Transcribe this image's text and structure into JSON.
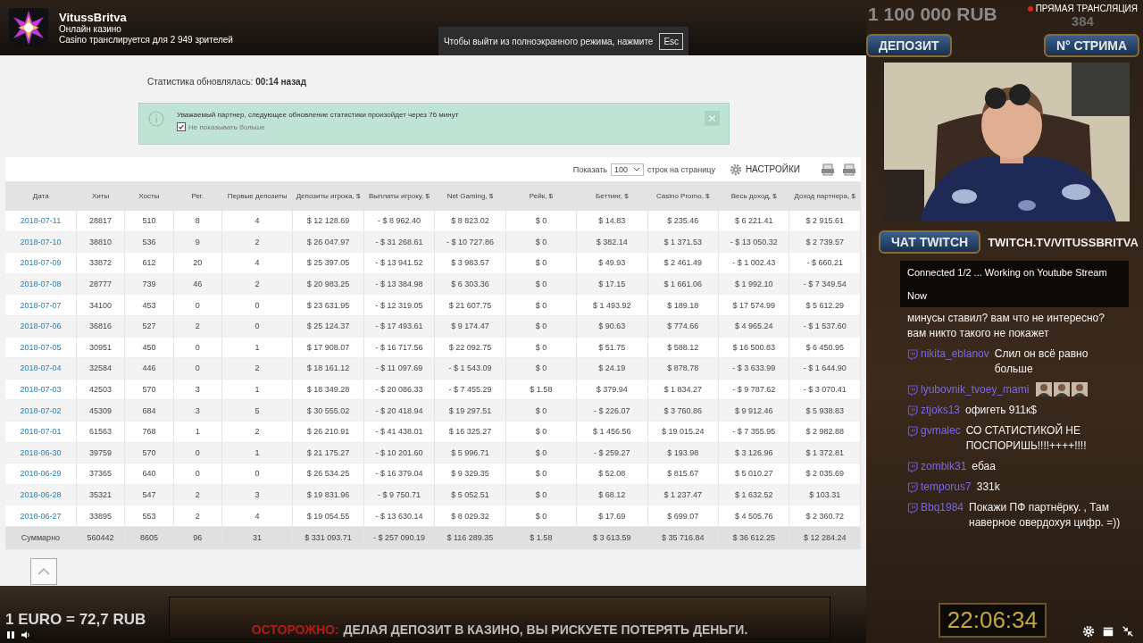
{
  "stream_header": {
    "channel": "VitussBritva",
    "subtitle": "Онлайн казино",
    "viewers": "Casino транслируется для 2 949 зрителей"
  },
  "fullscreen_notice": {
    "text": "Чтобы выйти из полноэкранного режима, нажмите",
    "key": "Esc"
  },
  "stats_updated": "Статистика обновлялась: **00:14 назад**",
  "alert": {
    "text": "Уважаемый партнер, следующее обновление статистики произойдет через 76 минут",
    "checkbox": {
      "label": "Не показывать больше",
      "checked": true
    }
  },
  "table_toolbar": {
    "show_label": "Показать",
    "page_size": "100",
    "per_page_label": "строк на страницу",
    "settings": "НАСТРОЙКИ"
  },
  "table": {
    "columns": [
      "Дата",
      "Хиты",
      "Хосты",
      "Рег.",
      "Первые депозиты",
      "Депозиты игрока, $",
      "Выплаты игроку, $",
      "Net Gaming, $",
      "Рейк, $",
      "Беттинг, $",
      "Casino Promo, $",
      "Весь доход, $",
      "Доход партнера, $"
    ],
    "rows": [
      [
        "2018-07-11",
        "28817",
        "510",
        "8",
        "4",
        "$ 12 128.69",
        "- $ 8 962.40",
        "$ 8 823.02",
        "$ 0",
        "$ 14.83",
        "$ 235.46",
        "$ 6 221.41",
        "$ 2 915.61"
      ],
      [
        "2018-07-10",
        "38810",
        "536",
        "9",
        "2",
        "$ 26 047.97",
        "- $ 31 268.61",
        "- $ 10 727.86",
        "$ 0",
        "$ 382.14",
        "$ 1 371.53",
        "- $ 13 050.32",
        "$ 2 739.57"
      ],
      [
        "2018-07-09",
        "33872",
        "612",
        "20",
        "4",
        "$ 25 397.05",
        "- $ 13 941.52",
        "$ 3 983.57",
        "$ 0",
        "$ 49.93",
        "$ 2 461.49",
        "- $ 1 002.43",
        "- $ 660.21"
      ],
      [
        "2018-07-08",
        "28777",
        "739",
        "46",
        "2",
        "$ 20 983.25",
        "- $ 13 384.98",
        "$ 6 303.36",
        "$ 0",
        "$ 17.15",
        "$ 1 661.06",
        "$ 1 992.10",
        "- $ 7 349.54"
      ],
      [
        "2018-07-07",
        "34100",
        "453",
        "0",
        "0",
        "$ 23 631.95",
        "- $ 12 319.05",
        "$ 21 607.75",
        "$ 0",
        "$ 1 493.92",
        "$ 189.18",
        "$ 17 574.99",
        "$ 5 612.29"
      ],
      [
        "2018-07-06",
        "36816",
        "527",
        "2",
        "0",
        "$ 25 124.37",
        "- $ 17 493.61",
        "$ 9 174.47",
        "$ 0",
        "$ 90.63",
        "$ 774.66",
        "$ 4 965.24",
        "- $ 1 537.60"
      ],
      [
        "2018-07-05",
        "30951",
        "450",
        "0",
        "1",
        "$ 17 908.07",
        "- $ 16 717.56",
        "$ 22 092.75",
        "$ 0",
        "$ 51.75",
        "$ 588.12",
        "$ 16 500.83",
        "$ 6 450.95"
      ],
      [
        "2018-07-04",
        "32584",
        "446",
        "0",
        "2",
        "$ 18 161.12",
        "- $ 11 097.69",
        "- $ 1 543.09",
        "$ 0",
        "$ 24.19",
        "$ 878.78",
        "- $ 3 633.99",
        "- $ 1 644.90"
      ],
      [
        "2018-07-03",
        "42503",
        "570",
        "3",
        "1",
        "$ 18 349.28",
        "- $ 20 086.33",
        "- $ 7 455.29",
        "$ 1.58",
        "$ 379.94",
        "$ 1 834.27",
        "- $ 9 787.62",
        "- $ 3 070.41"
      ],
      [
        "2018-07-02",
        "45309",
        "684",
        "3",
        "5",
        "$ 30 555.02",
        "- $ 20 418.94",
        "$ 19 297.51",
        "$ 0",
        "- $ 226.07",
        "$ 3 760.86",
        "$ 9 912.46",
        "$ 5 938.83"
      ],
      [
        "2018-07-01",
        "61563",
        "768",
        "1",
        "2",
        "$ 26 210.91",
        "- $ 41 438.01",
        "$ 16 325.27",
        "$ 0",
        "$ 1 456.56",
        "$ 19 015.24",
        "- $ 7 355.95",
        "$ 2 982.88"
      ],
      [
        "2018-06-30",
        "39759",
        "570",
        "0",
        "1",
        "$ 21 175.27",
        "- $ 10 201.60",
        "$ 5 996.71",
        "$ 0",
        "- $ 259.27",
        "$ 193.98",
        "$ 3 126.96",
        "$ 1 372.81"
      ],
      [
        "2018-06-29",
        "37365",
        "640",
        "0",
        "0",
        "$ 26 534.25",
        "- $ 16 379.04",
        "$ 9 329.35",
        "$ 0",
        "$ 52.08",
        "$ 815.67",
        "$ 5 010.27",
        "$ 2 035.69"
      ],
      [
        "2018-06-28",
        "35321",
        "547",
        "2",
        "3",
        "$ 19 831.96",
        "- $ 9 750.71",
        "$ 5 052.51",
        "$ 0",
        "$ 68.12",
        "$ 1 237.47",
        "$ 1 632.52",
        "$ 103.31"
      ],
      [
        "2018-06-27",
        "33895",
        "553",
        "2",
        "4",
        "$ 19 054.55",
        "- $ 13 630.14",
        "$ 8 029.32",
        "$ 0",
        "$ 17.69",
        "$ 699.07",
        "$ 4 505.76",
        "$ 2 360.72"
      ]
    ],
    "total": [
      "Суммарно",
      "560442",
      "8605",
      "96",
      "31",
      "$ 331 093.71",
      "- $ 257 090.19",
      "$ 116 289.35",
      "$ 1.58",
      "$ 3 613.59",
      "$ 35 716.84",
      "$ 36 612.25",
      "$ 12 284.24"
    ]
  },
  "overlay": {
    "goal": "1 100 000 RUB",
    "live": "ПРЯМАЯ ТРАНСЛЯЦИЯ",
    "stream_number": "384",
    "buttons": [
      "ДЕПОЗИТ",
      "N° СТРИМА"
    ],
    "chat_label": "ЧАТ TWITCH",
    "channel_url": "TWITCH.TV/VITUSSBRITVA",
    "clock": "22:06:34",
    "rate": "1 EURO = 72,7 RUB",
    "warning_label": "ОСТОРОЖНО:",
    "warning": "ДЕЛАЯ ДЕПОЗИТ В КАЗИНО, ВЫ РИСКУЕТЕ ПОТЕРЯТЬ ДЕНЬГИ."
  },
  "chat": {
    "status": "Connected 1/2 ... Working on Youtube Stream",
    "status_time": "Now",
    "messages": [
      {
        "kind": "text",
        "text": "минусы ставил? вам что не интересно? вам никто такого не покажет"
      },
      {
        "kind": "text",
        "user": "nikita_eblanov",
        "text": "Слил он всё равно больше"
      },
      {
        "kind": "emotes",
        "user": "lyubovnik_tvoey_mami"
      },
      {
        "kind": "text",
        "user": "ztjoks13",
        "text": "офигеть 911к$"
      },
      {
        "kind": "text",
        "user": "gvmalec",
        "text": "СО СТАТИСТИКОЙ НЕ ПОСПОРИШЬ!!!!++++!!!!"
      },
      {
        "kind": "text",
        "user": "zombik31",
        "text": "ебаа"
      },
      {
        "kind": "text",
        "user": "temporus7",
        "text": "331k"
      },
      {
        "kind": "text",
        "user": "Bbq1984",
        "text": "Покажи ПФ партнёрку. , Там наверное овердохуя цифр. =))"
      }
    ]
  }
}
